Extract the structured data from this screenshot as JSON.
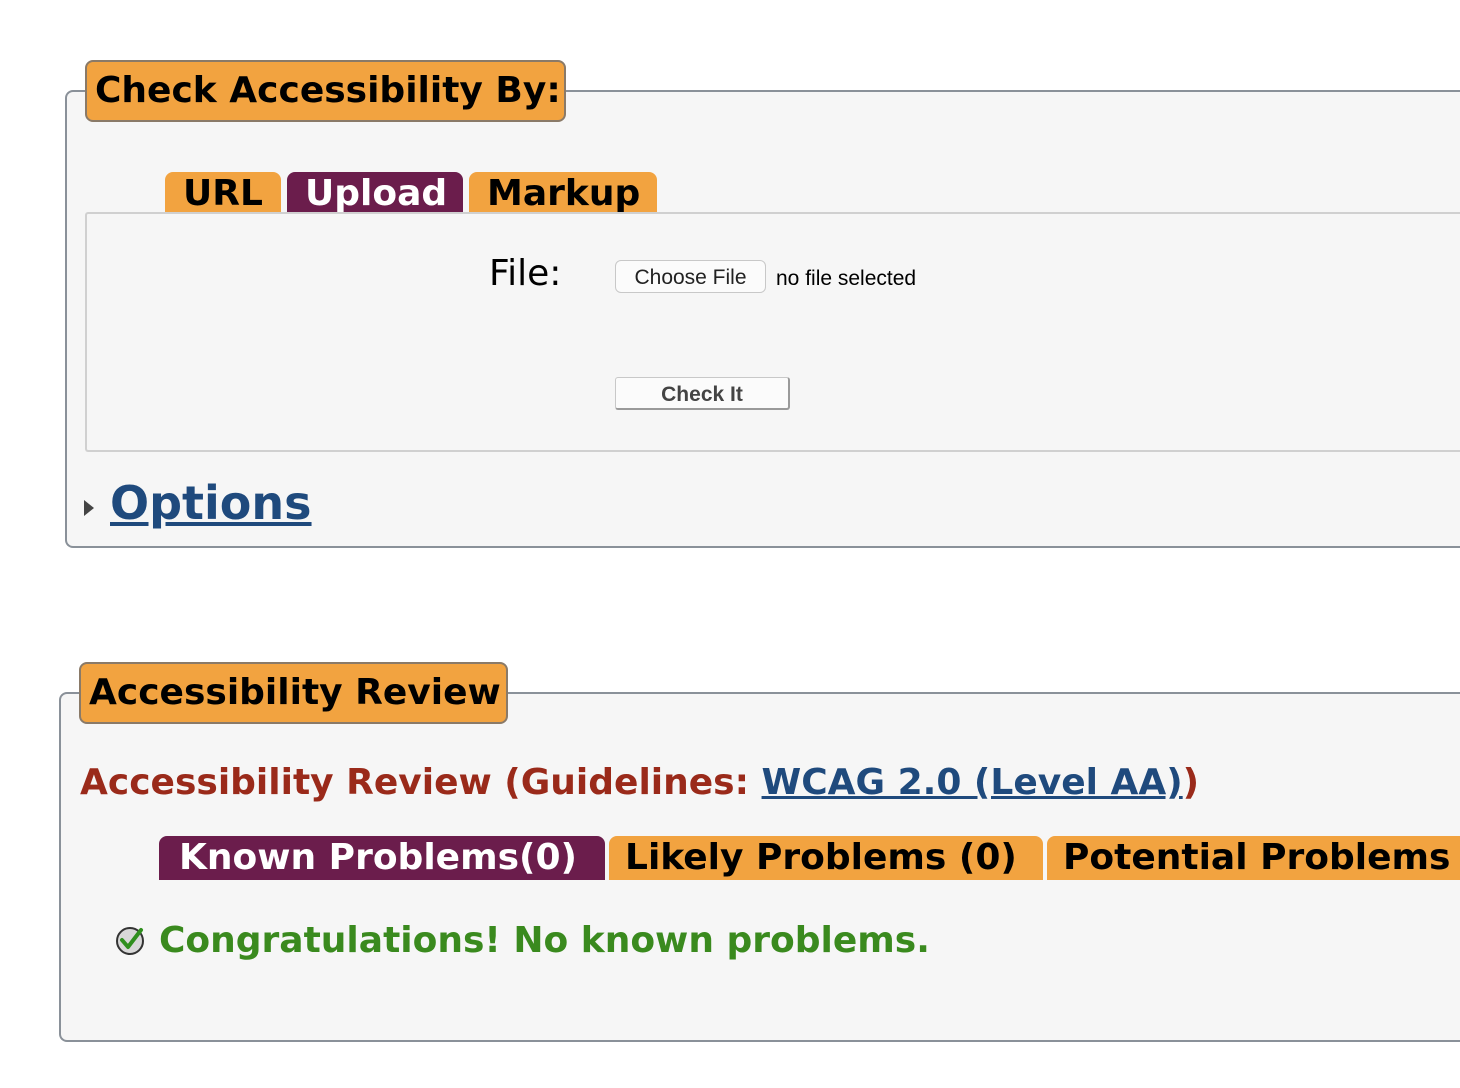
{
  "check_section": {
    "legend": "Check Accessibility By:",
    "tabs": [
      {
        "label": "URL",
        "active": false
      },
      {
        "label": "Upload",
        "active": true
      },
      {
        "label": "Markup",
        "active": false
      }
    ],
    "file_label": "File:",
    "choose_file_label": "Choose File",
    "no_file_text": "no file selected",
    "check_button_label": "Check It",
    "options_label": "Options"
  },
  "review_section": {
    "legend": "Accessibility Review",
    "heading_prefix": "Accessibility Review (Guidelines: ",
    "guideline_link": "WCAG 2.0 (Level AA)",
    "heading_suffix": ")",
    "tabs": [
      {
        "label": "Known Problems(0)",
        "active": true
      },
      {
        "label": "Likely Problems (0)",
        "active": false
      },
      {
        "label": "Potential Problems",
        "active": false
      }
    ],
    "success_message": "Congratulations! No known problems."
  },
  "colors": {
    "tab_orange": "#f2a340",
    "tab_purple": "#6b1d4c",
    "heading_red": "#9a2a1a",
    "link_blue": "#1f4a7d",
    "success_green": "#3a8a1e"
  }
}
